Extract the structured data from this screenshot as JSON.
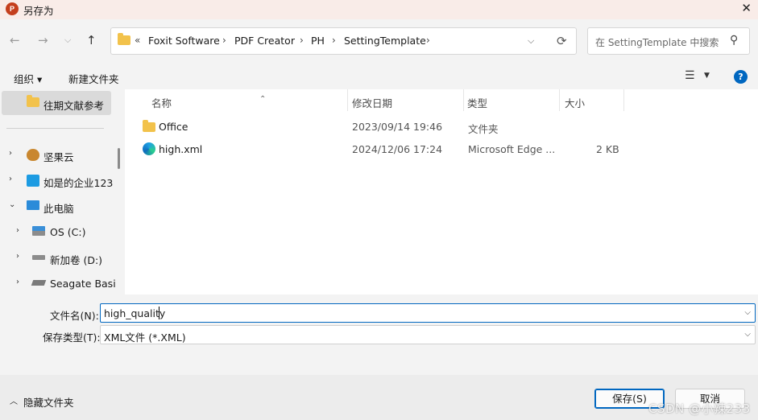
{
  "window": {
    "app_icon": "P",
    "title": "另存为",
    "close_icon": "✕"
  },
  "nav": {
    "back_icon": "←",
    "forward_icon": "→",
    "history_icon": "⌵",
    "up_icon": "↑",
    "path_prefix": "«",
    "path": [
      "Foxit Software",
      "PDF Creator",
      "PH",
      "SettingTemplate"
    ],
    "separator": "›",
    "dropdown_icon": "⌵",
    "refresh_icon": "⟳"
  },
  "search": {
    "placeholder": "在 SettingTemplate 中搜索",
    "icon": "⚲"
  },
  "toolbar": {
    "organize": "组织 ▾",
    "new_folder": "新建文件夹",
    "view_icon": "☰",
    "view_dd": "▼",
    "help_icon": "?"
  },
  "sidebar": {
    "quick": {
      "label": "往期文献参考",
      "icon": "folder-icon"
    },
    "items": [
      {
        "label": "坚果云",
        "arrow": "›",
        "icon": "nut-icon"
      },
      {
        "label": "如是的企业123",
        "arrow": "›",
        "icon": "building-icon"
      },
      {
        "label": "此电脑",
        "arrow": "⌄",
        "icon": "monitor-icon"
      },
      {
        "label": "OS (C:)",
        "arrow": "›",
        "icon": "windows-drive-icon"
      },
      {
        "label": "新加卷 (D:)",
        "arrow": "›",
        "icon": "drive-icon"
      },
      {
        "label": "Seagate Basi",
        "arrow": "›",
        "icon": "external-drive-icon"
      }
    ]
  },
  "columns": {
    "name": "名称",
    "date": "修改日期",
    "type": "类型",
    "size": "大小",
    "sort_caret": "⌃"
  },
  "files": [
    {
      "name": "Office",
      "date": "2023/09/14 19:46",
      "type": "文件夹",
      "size": "",
      "icon": "folder-icon"
    },
    {
      "name": "high.xml",
      "date": "2024/12/06 17:24",
      "type": "Microsoft Edge ...",
      "size": "2 KB",
      "icon": "edge-icon"
    }
  ],
  "form": {
    "filename_label": "文件名(N):",
    "filename_value": "high_quality",
    "filetype_label": "保存类型(T):",
    "filetype_value": "XML文件 (*.XML)",
    "dd_icon": "⌵"
  },
  "footer": {
    "hide_icon": "︿",
    "hide_label": "隐藏文件夹",
    "save": "保存(S)",
    "cancel": "取消",
    "watermark": "CSDN @小辣233"
  },
  "colors": {
    "accent": "#0067c0",
    "folder": "#f2c24b",
    "title_bg": "#f9ece8"
  }
}
